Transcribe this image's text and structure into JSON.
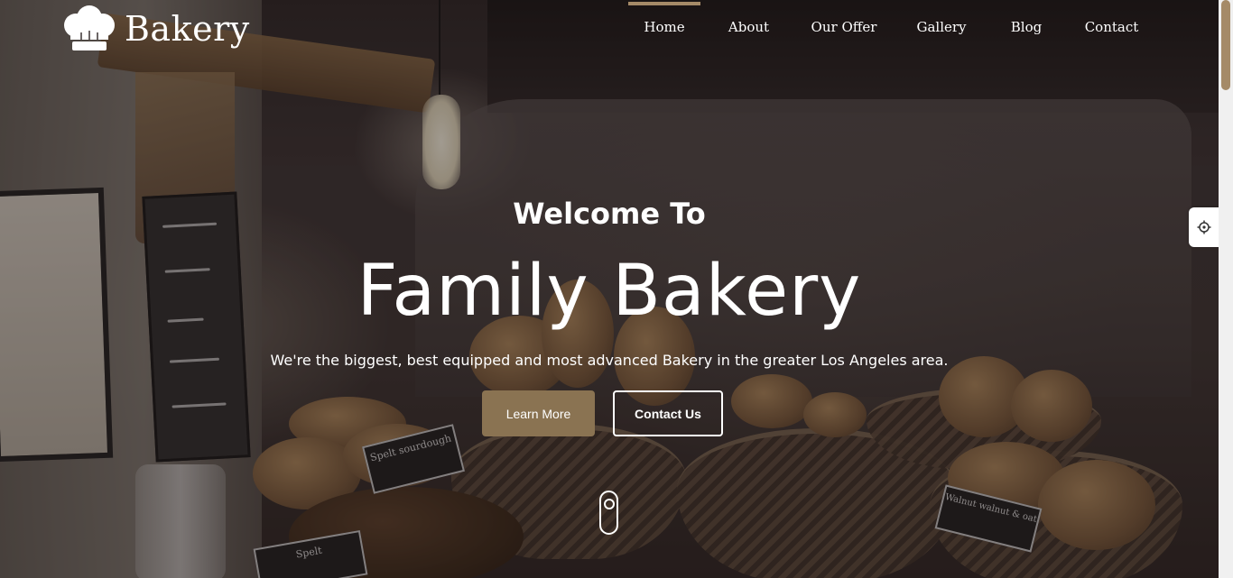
{
  "brand": {
    "name": "Bakery"
  },
  "nav": {
    "items": [
      {
        "label": "Home",
        "active": true
      },
      {
        "label": "About",
        "active": false
      },
      {
        "label": "Our Offer",
        "active": false
      },
      {
        "label": "Gallery",
        "active": false
      },
      {
        "label": "Blog",
        "active": false
      },
      {
        "label": "Contact",
        "active": false
      }
    ]
  },
  "hero": {
    "welcome": "Welcome To",
    "title": "Family Bakery",
    "subtitle": "We're the biggest, best equipped and most advanced Bakery in the greater Los Angeles area.",
    "learn_more_label": "Learn More",
    "contact_label": "Contact Us",
    "signs": [
      "Spelt sourdough",
      "Spelt",
      "Walnut walnut & oat"
    ]
  },
  "colors": {
    "accent": "#a58a67",
    "button_bg": "#8a7352",
    "text": "#ffffff"
  },
  "icons": {
    "logo": "chef-hat-icon",
    "settings": "gear-icon",
    "scroll": "mouse-scroll-icon"
  }
}
